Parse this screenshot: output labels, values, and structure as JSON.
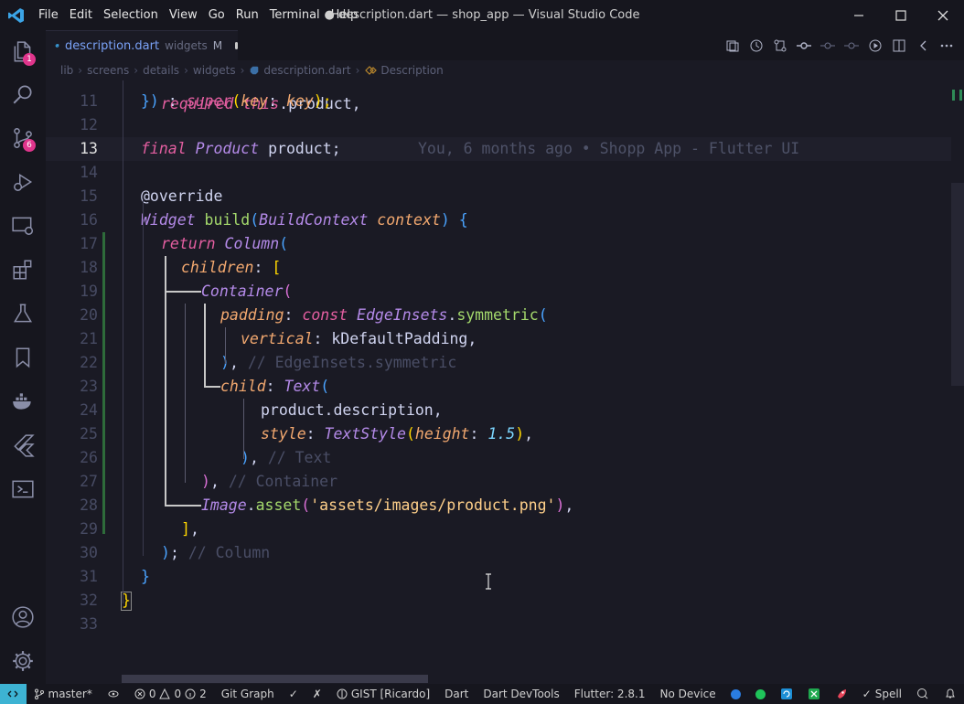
{
  "titlebar": {
    "menus": [
      "File",
      "Edit",
      "Selection",
      "View",
      "Go",
      "Run",
      "Terminal",
      "Help"
    ],
    "title": "● description.dart — shop_app — Visual Studio Code"
  },
  "activity": {
    "explorer_badge": "1",
    "scm_badge": "6"
  },
  "tab": {
    "name": "description.dart",
    "dir": "widgets",
    "status": "M"
  },
  "breadcrumb": [
    "lib",
    "screens",
    "details",
    "widgets",
    "description.dart",
    "Description"
  ],
  "blame": "You, 6 months ago • Shopp App - Flutter UI",
  "line_numbers": [
    "11",
    "12",
    "13",
    "14",
    "15",
    "16",
    "17",
    "18",
    "19",
    "20",
    "21",
    "22",
    "23",
    "24",
    "25",
    "26",
    "27",
    "28",
    "29",
    "30",
    "31",
    "32",
    "33"
  ],
  "active_line": "13",
  "code": {
    "l11": [
      [
        "})",
        "br3"
      ],
      [
        " : ",
        "pl"
      ],
      [
        "super",
        "kw"
      ],
      [
        "(",
        "br1"
      ],
      [
        "key",
        "pr"
      ],
      [
        ": ",
        "pl"
      ],
      [
        "key",
        "pr"
      ],
      [
        ");",
        "br1"
      ]
    ],
    "l13": [
      [
        "final ",
        "kw"
      ],
      [
        "Product ",
        "ty"
      ],
      [
        "product;",
        "pl"
      ]
    ],
    "l15": [
      [
        "@override",
        "pl"
      ]
    ],
    "l16": [
      [
        "Widget ",
        "ty"
      ],
      [
        "build",
        "fn"
      ],
      [
        "(",
        "br3"
      ],
      [
        "BuildContext ",
        "ty"
      ],
      [
        "context",
        "pr"
      ],
      [
        ")",
        "br3"
      ],
      [
        " {",
        "br3"
      ]
    ],
    "l17": [
      [
        "return ",
        "kw"
      ],
      [
        "Column",
        "ty"
      ],
      [
        "(",
        "br3"
      ]
    ],
    "l18": [
      [
        "children",
        "pr"
      ],
      [
        ": ",
        "pl"
      ],
      [
        "[",
        "br1"
      ]
    ],
    "l19": [
      [
        "Container",
        "ty"
      ],
      [
        "(",
        "br2"
      ]
    ],
    "l20": [
      [
        "padding",
        "pr"
      ],
      [
        ": ",
        "pl"
      ],
      [
        "const ",
        "kw"
      ],
      [
        "EdgeInsets",
        "ty"
      ],
      [
        ".",
        "pl"
      ],
      [
        "symmetric",
        "fn"
      ],
      [
        "(",
        "br3"
      ]
    ],
    "l21": [
      [
        "vertical",
        "pr"
      ],
      [
        ": ",
        "pl"
      ],
      [
        "kDefaultPadding,",
        "pl"
      ]
    ],
    "l22": [
      [
        ")",
        "br3"
      ],
      [
        ", ",
        "pl"
      ],
      [
        "// EdgeInsets.symmetric",
        "cm"
      ]
    ],
    "l23": [
      [
        "child",
        "pr"
      ],
      [
        ": ",
        "pl"
      ],
      [
        "Text",
        "ty"
      ],
      [
        "(",
        "br3"
      ]
    ],
    "l24": [
      [
        "product.description,",
        "pl"
      ]
    ],
    "l25": [
      [
        "style",
        "pr"
      ],
      [
        ": ",
        "pl"
      ],
      [
        "TextStyle",
        "ty"
      ],
      [
        "(",
        "br1"
      ],
      [
        "height",
        "pr"
      ],
      [
        ": ",
        "pl"
      ],
      [
        "1.5",
        "nu"
      ],
      [
        ")",
        "br1"
      ],
      [
        ",",
        "pl"
      ]
    ],
    "l26": [
      [
        ")",
        "br3"
      ],
      [
        ", ",
        "pl"
      ],
      [
        "// Text",
        "cm"
      ]
    ],
    "l27": [
      [
        ")",
        "br2"
      ],
      [
        ", ",
        "pl"
      ],
      [
        "// Container",
        "cm"
      ]
    ],
    "l28": [
      [
        "Image",
        "ty"
      ],
      [
        ".",
        "pl"
      ],
      [
        "asset",
        "fn"
      ],
      [
        "(",
        "br2"
      ],
      [
        "'assets/images/product.png'",
        "st"
      ],
      [
        ")",
        "br2"
      ],
      [
        ",",
        "pl"
      ]
    ],
    "l29": [
      [
        "]",
        "br1"
      ],
      [
        ",",
        "pl"
      ]
    ],
    "l30": [
      [
        ")",
        "br3"
      ],
      [
        "; ",
        "pl"
      ],
      [
        "// Column",
        "cm"
      ]
    ],
    "l31": [
      [
        "}",
        "br3"
      ]
    ],
    "l32": [
      [
        "}",
        "br1"
      ]
    ]
  },
  "statusbar": {
    "branch": "master*",
    "errors": "0",
    "warnings": "0",
    "info": "2",
    "git_graph": "Git Graph",
    "gist": "GIST [Ricardo]",
    "lang": "Dart",
    "devtools": "Dart DevTools",
    "flutter": "Flutter: 2.8.1",
    "device": "No Device",
    "spell": "Spell"
  },
  "colors": {
    "accent": "#3db3d3",
    "badge": "#e0358c"
  }
}
